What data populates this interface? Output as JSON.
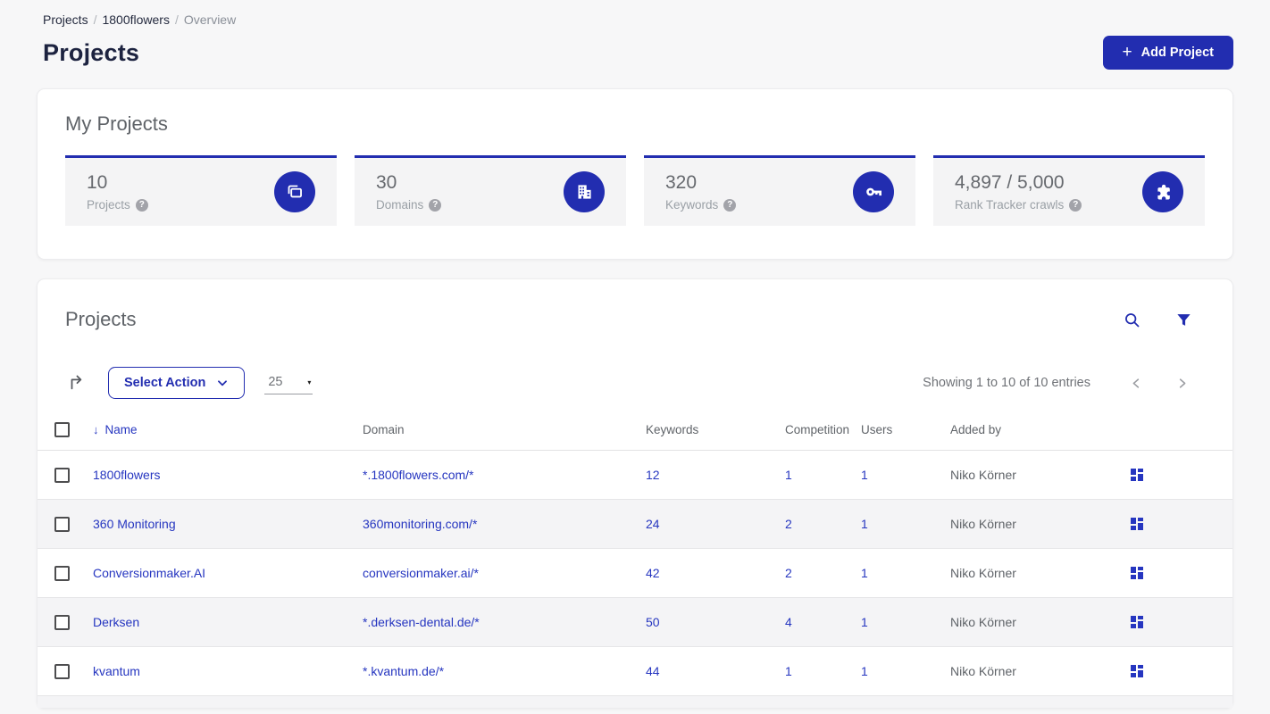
{
  "colors": {
    "primary": "#222db0",
    "link": "#2636c0"
  },
  "breadcrumb": {
    "separator": "/",
    "items": [
      {
        "label": "Projects"
      },
      {
        "label": "1800flowers"
      },
      {
        "label": "Overview"
      }
    ]
  },
  "header": {
    "title": "Projects",
    "add_button": {
      "label": "Add Project",
      "plus": "+"
    }
  },
  "my_projects": {
    "title": "My Projects",
    "stats": [
      {
        "value": "10",
        "label": "Projects",
        "icon": "projects-icon"
      },
      {
        "value": "30",
        "label": "Domains",
        "icon": "building-icon"
      },
      {
        "value": "320",
        "label": "Keywords",
        "icon": "key-icon"
      },
      {
        "value": "4,897 / 5,000",
        "label": "Rank Tracker crawls",
        "icon": "puzzle-icon"
      }
    ],
    "help_glyph": "?"
  },
  "projects_panel": {
    "title": "Projects",
    "toolbar": {
      "select_action_label": "Select Action",
      "page_size": "25",
      "page_size_caret": "▾",
      "showing_text": "Showing 1 to 10 of 10 entries"
    },
    "table": {
      "sort_arrow": "↓",
      "columns": [
        "Name",
        "Domain",
        "Keywords",
        "Competition",
        "Users",
        "Added by"
      ],
      "rows": [
        {
          "name": "1800flowers",
          "domain": "*.1800flowers.com/*",
          "keywords": "12",
          "competition": "1",
          "users": "1",
          "added_by": "Niko Körner"
        },
        {
          "name": "360 Monitoring",
          "domain": "360monitoring.com/*",
          "keywords": "24",
          "competition": "2",
          "users": "1",
          "added_by": "Niko Körner"
        },
        {
          "name": "Conversionmaker.AI",
          "domain": "conversionmaker.ai/*",
          "keywords": "42",
          "competition": "2",
          "users": "1",
          "added_by": "Niko Körner"
        },
        {
          "name": "Derksen",
          "domain": "*.derksen-dental.de/*",
          "keywords": "50",
          "competition": "4",
          "users": "1",
          "added_by": "Niko Körner"
        },
        {
          "name": "kvantum",
          "domain": "*.kvantum.de/*",
          "keywords": "44",
          "competition": "1",
          "users": "1",
          "added_by": "Niko Körner"
        }
      ]
    }
  }
}
